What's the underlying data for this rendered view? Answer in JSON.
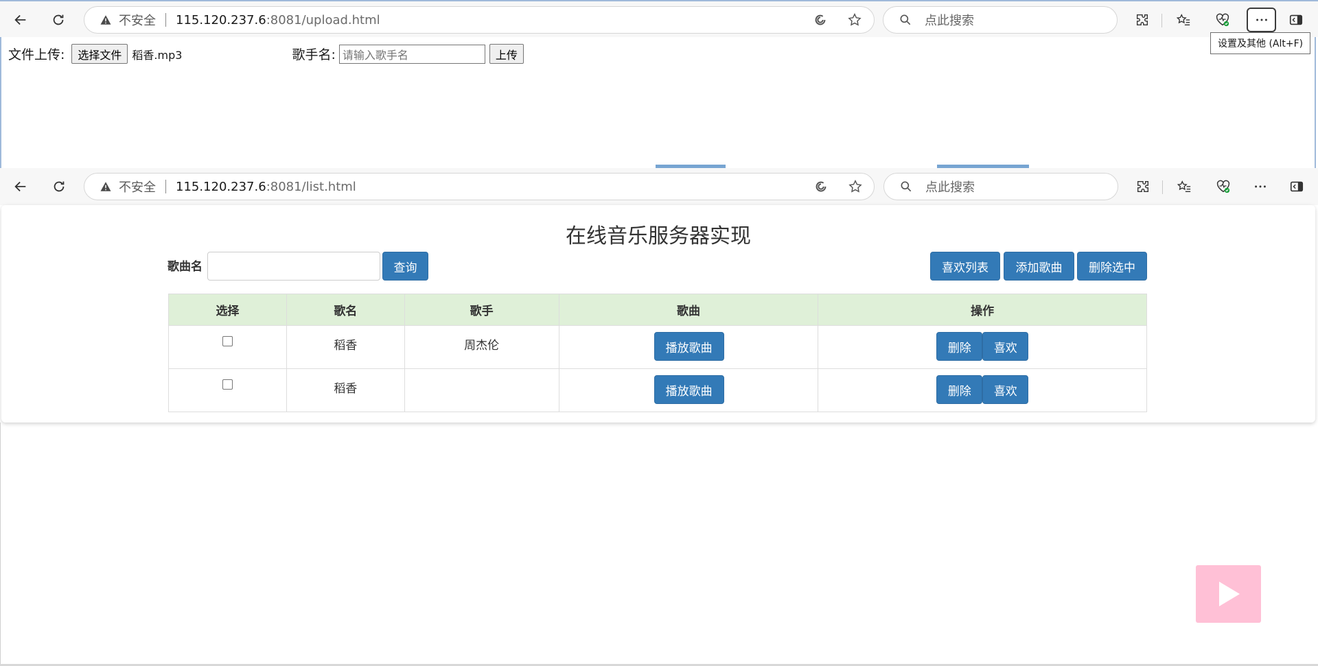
{
  "browser_top": {
    "insecure_label": "不安全",
    "url_host": "115.120.237.6",
    "url_path": ":8081/upload.html",
    "search_placeholder": "点此搜索",
    "more_tooltip": "设置及其他 (Alt+F)"
  },
  "upload_page": {
    "file_label": "文件上传:",
    "choose_file_label": "选择文件",
    "selected_file": "稻香.mp3",
    "singer_label": "歌手名:",
    "singer_placeholder": "请输入歌手名",
    "upload_label": "上传"
  },
  "browser_bottom": {
    "insecure_label": "不安全",
    "url_host": "115.120.237.6",
    "url_path": ":8081/list.html",
    "search_placeholder": "点此搜索"
  },
  "list_page": {
    "title": "在线音乐服务器实现",
    "search_label": "歌曲名",
    "search_value": "",
    "query_label": "查询",
    "favorite_list_label": "喜欢列表",
    "add_song_label": "添加歌曲",
    "delete_selected_label": "删除选中",
    "columns": [
      "选择",
      "歌名",
      "歌手",
      "歌曲",
      "操作"
    ],
    "rows": [
      {
        "checked": false,
        "name": "稻香",
        "singer": "周杰伦",
        "play_label": "播放歌曲",
        "delete_label": "删除",
        "like_label": "喜欢"
      },
      {
        "checked": false,
        "name": "稻香",
        "singer": "",
        "play_label": "播放歌曲",
        "delete_label": "删除",
        "like_label": "喜欢"
      }
    ]
  },
  "colors": {
    "primary_button": "#337ab7",
    "table_header": "#dff0d8",
    "play_widget": "#ffc0d6"
  }
}
